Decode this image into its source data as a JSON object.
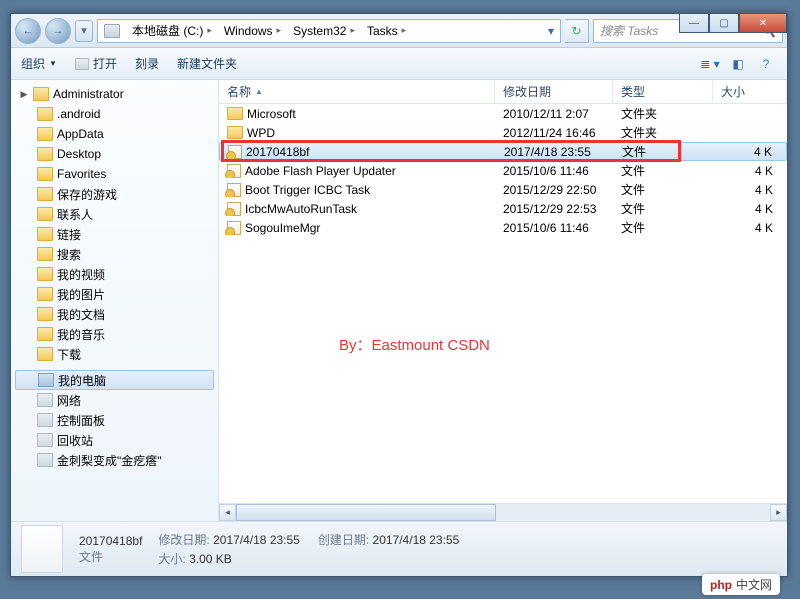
{
  "window_controls": {
    "min": "—",
    "max": "▢",
    "close": "✕"
  },
  "nav": {
    "back": "←",
    "fwd": "→",
    "crumbs": [
      "本地磁盘 (C:)",
      "Windows",
      "System32",
      "Tasks"
    ],
    "sep": "▸",
    "refresh": "↻",
    "search_placeholder": "搜索 Tasks",
    "search_icon": "🔍"
  },
  "toolbar": {
    "organize": "组织",
    "open": "打开",
    "burn": "刻录",
    "newfolder": "新建文件夹"
  },
  "tree": {
    "root": "Administrator",
    "items": [
      ".android",
      "AppData",
      "Desktop",
      "Favorites",
      "保存的游戏",
      "联系人",
      "链接",
      "搜索",
      "我的视频",
      "我的图片",
      "我的文档",
      "我的音乐",
      "下载"
    ],
    "second_group": [
      "我的电脑",
      "网络",
      "控制面板",
      "回收站",
      "金刺梨变成\"金疙瘩\""
    ]
  },
  "columns": {
    "name": "名称",
    "date": "修改日期",
    "type": "类型",
    "size": "大小",
    "sort": "▲"
  },
  "files": [
    {
      "name": "Microsoft",
      "date": "2010/12/11 2:07",
      "type": "文件夹",
      "size": "",
      "kind": "folder"
    },
    {
      "name": "WPD",
      "date": "2012/11/24 16:46",
      "type": "文件夹",
      "size": "",
      "kind": "folder"
    },
    {
      "name": "20170418bf",
      "date": "2017/4/18 23:55",
      "type": "文件",
      "size": "4 K",
      "kind": "file-lock",
      "selected": true,
      "highlighted": true
    },
    {
      "name": "Adobe Flash Player Updater",
      "date": "2015/10/6 11:46",
      "type": "文件",
      "size": "4 K",
      "kind": "file-lock"
    },
    {
      "name": "Boot Trigger ICBC Task",
      "date": "2015/12/29 22:50",
      "type": "文件",
      "size": "4 K",
      "kind": "file-lock"
    },
    {
      "name": "IcbcMwAutoRunTask",
      "date": "2015/12/29 22:53",
      "type": "文件",
      "size": "4 K",
      "kind": "file-lock"
    },
    {
      "name": "SogouImeMgr",
      "date": "2015/10/6 11:46",
      "type": "文件",
      "size": "4 K",
      "kind": "file-lock"
    }
  ],
  "watermark": "By：Eastmount CSDN",
  "details": {
    "filename": "20170418bf",
    "filetype": "文件",
    "mod_label": "修改日期:",
    "mod_value": "2017/4/18 23:55",
    "size_label": "大小:",
    "size_value": "3.00 KB",
    "create_label": "创建日期:",
    "create_value": "2017/4/18 23:55"
  },
  "badge": {
    "prefix": "php",
    "suffix": "中文网"
  }
}
